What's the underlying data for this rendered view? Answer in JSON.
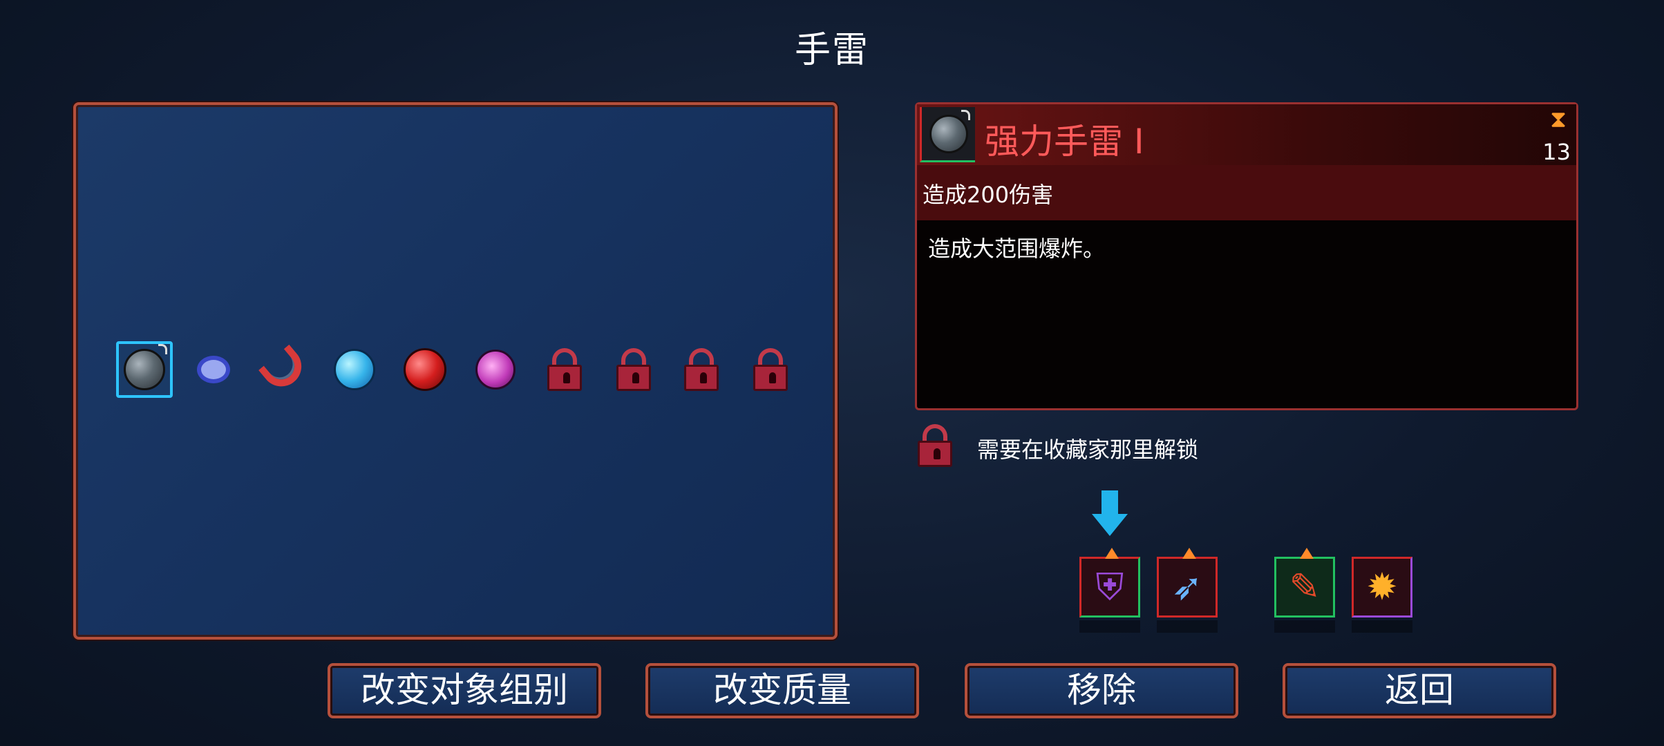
{
  "header": {
    "title": "手雷"
  },
  "items": [
    {
      "name": "grenade",
      "icon": "grenade-icon",
      "selected": true,
      "locked": false
    },
    {
      "name": "ring",
      "icon": "ring-icon",
      "selected": false,
      "locked": false
    },
    {
      "name": "magnet",
      "icon": "magnet-icon",
      "selected": false,
      "locked": false
    },
    {
      "name": "ice-grenade",
      "icon": "ice-grenade-icon",
      "selected": false,
      "locked": false
    },
    {
      "name": "fire-grenade",
      "icon": "fire-grenade-icon",
      "selected": false,
      "locked": false
    },
    {
      "name": "poison-flask",
      "icon": "poison-flask-icon",
      "selected": false,
      "locked": false
    },
    {
      "name": "locked-1",
      "icon": "lock-icon",
      "locked": true
    },
    {
      "name": "locked-2",
      "icon": "lock-icon",
      "locked": true
    },
    {
      "name": "locked-3",
      "icon": "lock-icon",
      "locked": true
    },
    {
      "name": "locked-4",
      "icon": "lock-icon",
      "locked": true
    }
  ],
  "detail": {
    "name": "强力手雷 I",
    "timer_icon": "hourglass-icon",
    "timer_value": "13",
    "stat": "造成200伤害",
    "description": "造成大范围爆炸。",
    "name_color": "#ff5a5a"
  },
  "unlock": {
    "text": "需要在收藏家那里解锁"
  },
  "mutations": [
    {
      "icon": "purple-shield-icon"
    },
    {
      "icon": "blue-arrow-icon"
    },
    {
      "icon": "green-syringe-icon"
    },
    {
      "icon": "flame-icon"
    }
  ],
  "buttons": {
    "change_group": "改变对象组别",
    "change_quality": "改变质量",
    "remove": "移除",
    "back": "返回"
  },
  "colors": {
    "frame": "#b5503c",
    "selection": "#2ec4ff",
    "arrow": "#22b4ec",
    "lock": "#a8243a"
  }
}
